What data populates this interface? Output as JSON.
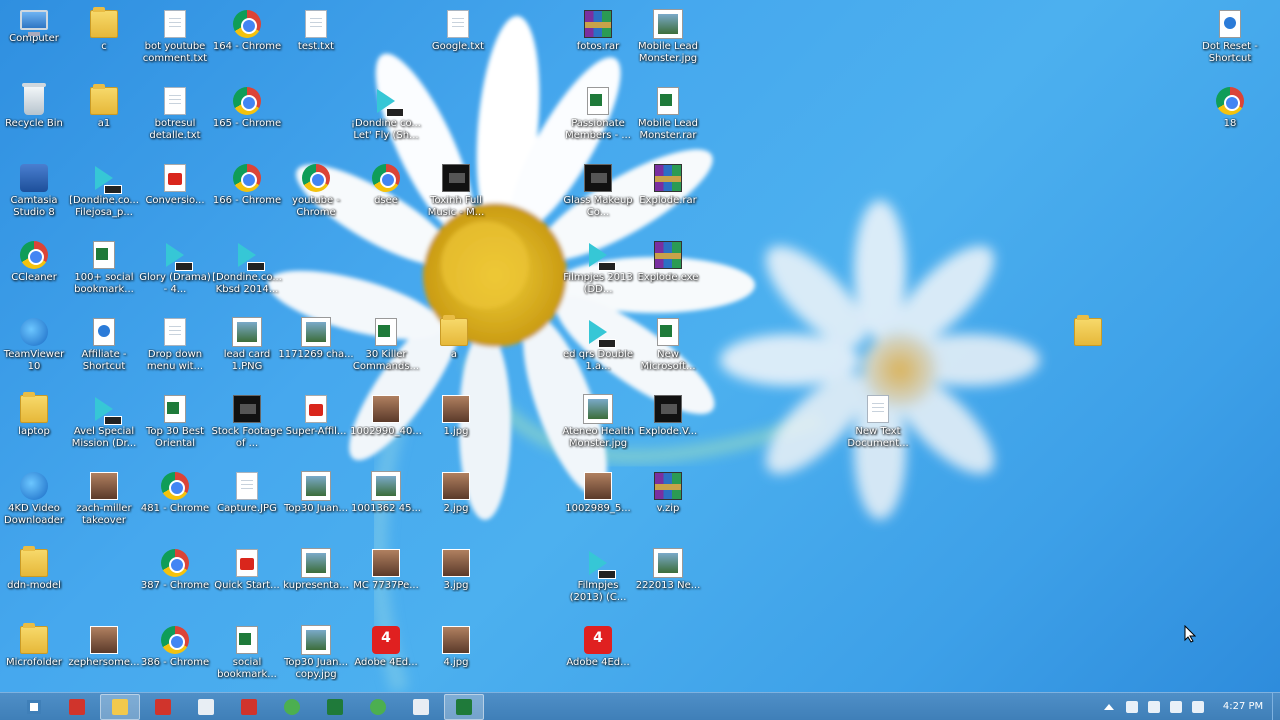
{
  "desktop": {
    "icons": [
      {
        "label": "Computer",
        "icon": "computer-icon"
      },
      {
        "label": "c",
        "icon": "folder-icon"
      },
      {
        "label": "bot youtube comment.txt",
        "icon": "text-file-icon"
      },
      {
        "label": "164 - Chrome",
        "icon": "chrome-icon"
      },
      {
        "label": "test.txt",
        "icon": "text-file-icon"
      },
      {
        "label": "Google.txt",
        "icon": "text-file-icon"
      },
      {
        "label": "fotos.rar",
        "icon": "winrar-icon"
      },
      {
        "label": "Mobile Lead Monster.jpg",
        "icon": "image-icon"
      },
      {
        "label": "Dot Reset - Shortcut",
        "icon": "shortcut-icon"
      },
      {
        "label": "Recycle Bin",
        "icon": "recycle-bin-icon"
      },
      {
        "label": "a1",
        "icon": "folder-icon"
      },
      {
        "label": "botresul detalle.txt",
        "icon": "text-file-icon"
      },
      {
        "label": "165 - Chrome",
        "icon": "chrome-icon"
      },
      {
        "label": "¡Dondine co... Let' Fly (Sh...",
        "icon": "video-file-icon"
      },
      {
        "label": "Passionate Members - ...",
        "icon": "excel-icon"
      },
      {
        "label": "Mobile Lead Monster.rar",
        "icon": "excel-icon"
      },
      {
        "label": "18",
        "icon": "chrome-icon"
      },
      {
        "label": "Camtasia Studio 8",
        "icon": "camtasia-icon"
      },
      {
        "label": "[Dondine.co... Filejosa_p...",
        "icon": "video-file-icon"
      },
      {
        "label": "Conversio...",
        "icon": "pdf-icon"
      },
      {
        "label": "166 - Chrome",
        "icon": "chrome-icon"
      },
      {
        "label": "youtube - Chrome",
        "icon": "chrome-icon"
      },
      {
        "label": "dsee",
        "icon": "chrome-icon"
      },
      {
        "label": "Toxinh Full Music - M...",
        "icon": "video-dark-icon"
      },
      {
        "label": "Glass Makeup Co...",
        "icon": "app-dark-icon"
      },
      {
        "label": "Explode.rar",
        "icon": "winrar-icon"
      },
      {
        "label": "CCleaner",
        "icon": "ccleaner-icon"
      },
      {
        "label": "100+ social bookmark...",
        "icon": "excel-icon"
      },
      {
        "label": "Glory (Drama) - 4...",
        "icon": "video-file-icon"
      },
      {
        "label": "[Dondine.co... Kbsd 2014...",
        "icon": "video-file-icon"
      },
      {
        "label": "Filmpjes 2013 (DD...",
        "icon": "video-file-icon"
      },
      {
        "label": "Explode.exe",
        "icon": "winrar-icon"
      },
      {
        "label": "TeamViewer 10",
        "icon": "teamviewer-icon"
      },
      {
        "label": "Affiliate - Shortcut",
        "icon": "shortcut-icon"
      },
      {
        "label": "Drop down menu wit...",
        "icon": "app-window-icon"
      },
      {
        "label": "lead card 1.PNG",
        "icon": "image-icon"
      },
      {
        "label": "1171269 cha...",
        "icon": "image-icon"
      },
      {
        "label": "30 Killer Commands...",
        "icon": "excel-icon"
      },
      {
        "label": "a",
        "icon": "folder-icon"
      },
      {
        "label": "ed qrs Double 1.a...",
        "icon": "video-file-icon"
      },
      {
        "label": "New Microsoft...",
        "icon": "word-icon"
      },
      {
        "label": "",
        "icon": "folder-icon"
      },
      {
        "label": "laptop",
        "icon": "folder-icon"
      },
      {
        "label": "Avel Special Mission (Dr...",
        "icon": "video-file-icon"
      },
      {
        "label": "Top 30 Best Oriental",
        "icon": "excel-icon"
      },
      {
        "label": "Stock Footage of ...",
        "icon": "video-dark-icon"
      },
      {
        "label": "Super-Affil...",
        "icon": "pdf-icon"
      },
      {
        "label": "1002990_40...",
        "icon": "photo-icon"
      },
      {
        "label": "1.jpg",
        "icon": "photo-icon"
      },
      {
        "label": "Ateneo Health Monster.jpg",
        "icon": "image-icon"
      },
      {
        "label": "Explode.V...",
        "icon": "app-dark-icon"
      },
      {
        "label": "New Text Document...",
        "icon": "text-file-icon"
      },
      {
        "label": "4KD Video Downloader",
        "icon": "4kd-icon"
      },
      {
        "label": "zach-miller takeover",
        "icon": "photo-icon"
      },
      {
        "label": "481 - Chrome",
        "icon": "chrome-icon"
      },
      {
        "label": "Capture.JPG",
        "icon": "text-file-icon"
      },
      {
        "label": "Top30 Juan...",
        "icon": "image-icon"
      },
      {
        "label": "1001362 45...",
        "icon": "image-icon"
      },
      {
        "label": "2.jpg",
        "icon": "photo-icon"
      },
      {
        "label": "1002989_5...",
        "icon": "photo-icon"
      },
      {
        "label": "v.zip",
        "icon": "winrar-icon"
      },
      {
        "label": "ddn-model",
        "icon": "folder-icon"
      },
      {
        "label": "387 - Chrome",
        "icon": "chrome-icon"
      },
      {
        "label": "Quick Start...",
        "icon": "pdf-icon"
      },
      {
        "label": "kupresenta...",
        "icon": "image-icon"
      },
      {
        "label": "MC 7737Pe...",
        "icon": "photo-icon"
      },
      {
        "label": "3.jpg",
        "icon": "photo-icon"
      },
      {
        "label": "Filmpjes (2013) (C...",
        "icon": "video-file-icon"
      },
      {
        "label": "222013 Ne...",
        "icon": "image-icon"
      },
      {
        "label": "Microfolder",
        "icon": "folder-icon"
      },
      {
        "label": "zephersome...",
        "icon": "app-orange-icon"
      },
      {
        "label": "386 - Chrome",
        "icon": "chrome-icon"
      },
      {
        "label": "social bookmark...",
        "icon": "excel-icon"
      },
      {
        "label": "Top30 Juan... copy.jpg",
        "icon": "image-icon"
      },
      {
        "label": "Adobe 4Ed...",
        "icon": "adobe-red-icon"
      },
      {
        "label": "4.jpg",
        "icon": "photo-icon"
      },
      {
        "label": "Adobe 4Ed...",
        "icon": "adobe-red-icon"
      }
    ]
  },
  "taskbar": {
    "buttons": [
      {
        "name": "start-button",
        "icon": "windows-logo-icon"
      },
      {
        "name": "taskbar-app-1",
        "icon": "app-icon"
      },
      {
        "name": "taskbar-explorer",
        "icon": "folder-icon"
      },
      {
        "name": "taskbar-app-3",
        "icon": "app-icon"
      },
      {
        "name": "taskbar-app-4",
        "icon": "document-icon"
      },
      {
        "name": "taskbar-app-5",
        "icon": "app-icon"
      },
      {
        "name": "taskbar-chrome",
        "icon": "chrome-icon"
      },
      {
        "name": "taskbar-app-7",
        "icon": "excel-icon"
      },
      {
        "name": "taskbar-app-8",
        "icon": "chrome-icon"
      },
      {
        "name": "taskbar-app-9",
        "icon": "document-icon"
      },
      {
        "name": "taskbar-app-10",
        "icon": "excel-icon"
      }
    ],
    "clock": "4:27 PM"
  },
  "colors": {
    "wallpaper_blue": "#3d9ee6",
    "taskbar": "#4585bf",
    "daisy_center": "#e8b820"
  }
}
